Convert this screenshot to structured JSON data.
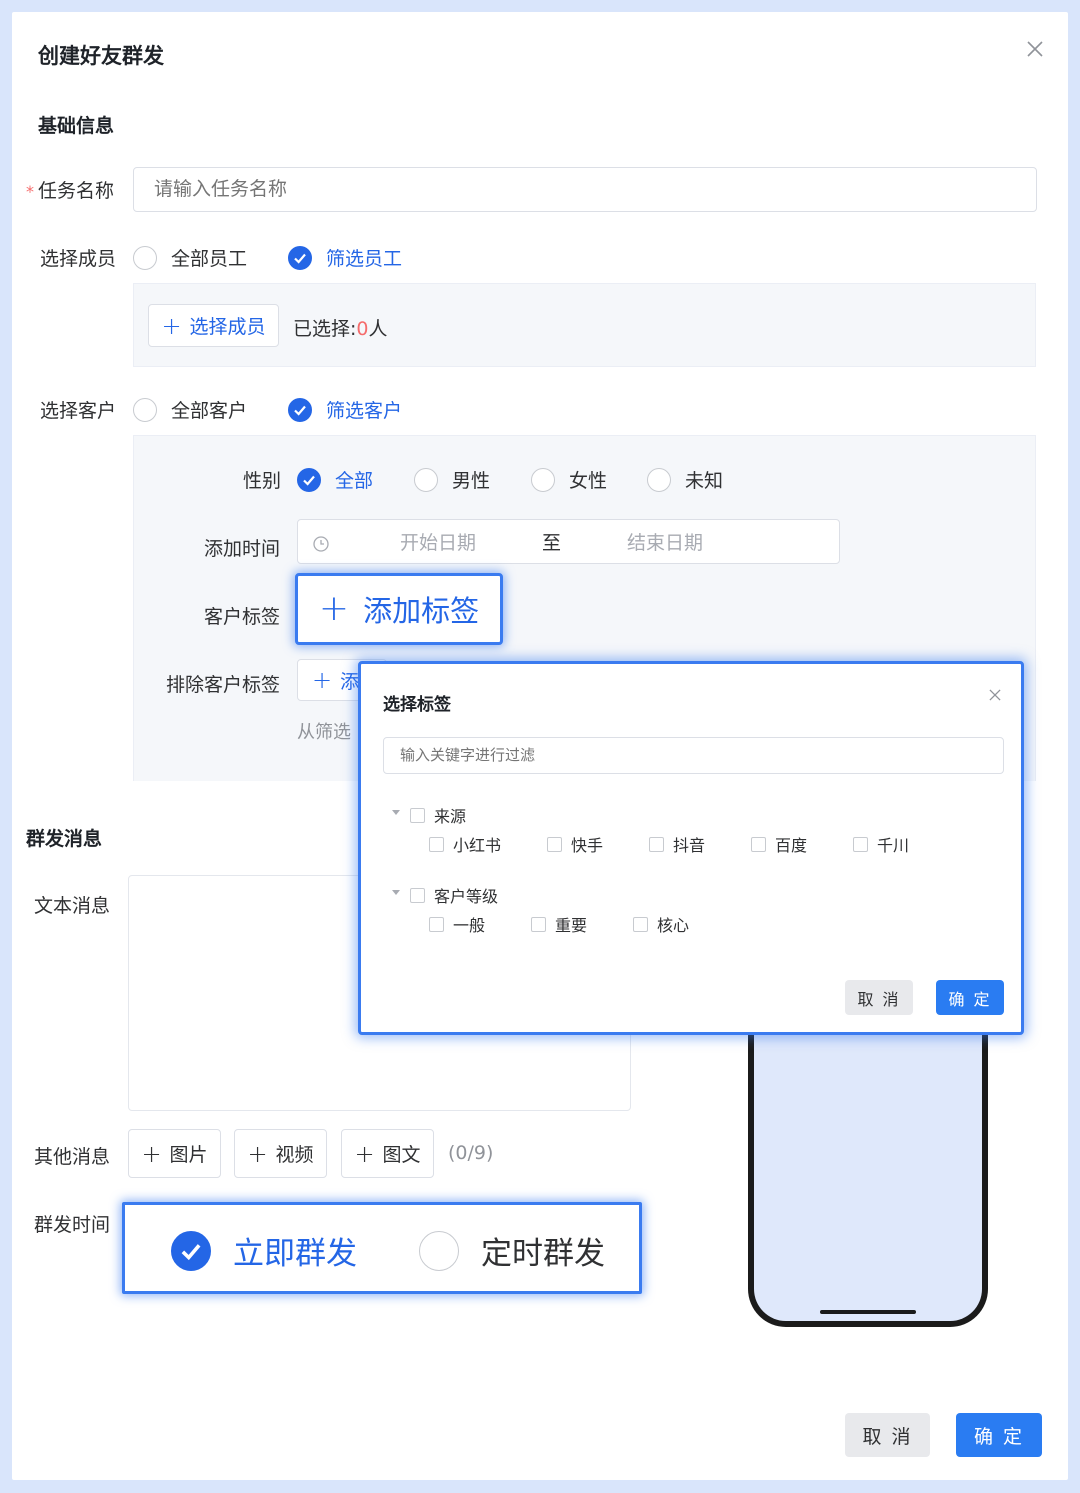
{
  "dialog": {
    "title": "创建好友群发",
    "confirm_label": "确 定",
    "cancel_label": "取 消"
  },
  "basic": {
    "section_title": "基础信息",
    "task_name": {
      "required_mark": "*",
      "label": "任务名称",
      "placeholder": "请输入任务名称"
    },
    "members": {
      "label": "选择成员",
      "option_all": "全部员工",
      "option_filter": "筛选员工",
      "selected_value": "筛选员工",
      "select_button": "选择成员",
      "selected_prefix": "已选择:",
      "selected_count": "0",
      "selected_unit": "人"
    },
    "customers": {
      "label": "选择客户",
      "option_all": "全部客户",
      "option_filter": "筛选客户",
      "selected_value": "筛选客户",
      "gender": {
        "label": "性别",
        "options": [
          "全部",
          "男性",
          "女性",
          "未知"
        ],
        "selected": "全部"
      },
      "add_time": {
        "label": "添加时间",
        "start_placeholder": "开始日期",
        "separator": "至",
        "end_placeholder": "结束日期"
      },
      "tags": {
        "label": "客户标签",
        "add_button": "添加标签"
      },
      "exclude_tags": {
        "label": "排除客户标签",
        "add_button_partial": "添",
        "hint_partial": "从筛选"
      }
    }
  },
  "message": {
    "section_title": "群发消息",
    "text_label": "文本消息",
    "other_label": "其他消息",
    "attach_buttons": [
      "图片",
      "视频",
      "图文"
    ],
    "attach_count": "(0/9)",
    "time_label": "群发时间",
    "time_options": [
      "立即群发",
      "定时群发"
    ],
    "time_selected": "立即群发"
  },
  "tag_modal": {
    "title": "选择标签",
    "filter_placeholder": "输入关键字进行过滤",
    "groups": [
      {
        "name": "来源",
        "items": [
          "小红书",
          "快手",
          "抖音",
          "百度",
          "千川"
        ]
      },
      {
        "name": "客户等级",
        "items": [
          "一般",
          "重要",
          "核心"
        ]
      }
    ],
    "cancel_label": "取 消",
    "confirm_label": "确 定"
  },
  "icons": {
    "close": "close-icon",
    "check": "check-icon",
    "plus": "plus-icon",
    "clock": "clock-icon",
    "caret": "caret-down-icon"
  },
  "colors": {
    "primary": "#2466e6",
    "required": "#f56c6c",
    "highlight": "#3a7bf0",
    "backdrop": "#d9e5fb"
  }
}
